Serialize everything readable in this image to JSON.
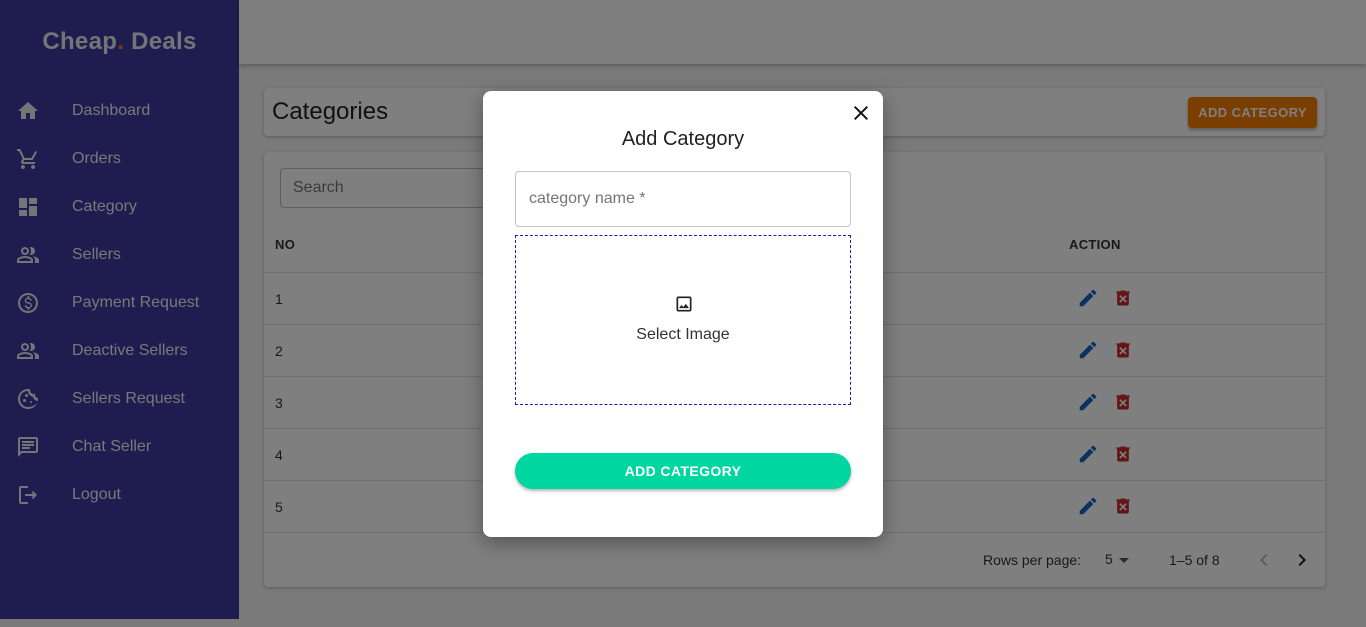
{
  "brand": {
    "name_part1": "Cheap",
    "dot": ".",
    "name_part2": " Deals"
  },
  "sidebar": {
    "items": [
      {
        "label": "Dashboard",
        "icon": "home-icon"
      },
      {
        "label": "Orders",
        "icon": "cart-icon"
      },
      {
        "label": "Category",
        "icon": "dashboard-grid-icon"
      },
      {
        "label": "Sellers",
        "icon": "people-icon"
      },
      {
        "label": "Payment Request",
        "icon": "dollar-circle-icon"
      },
      {
        "label": "Deactive Sellers",
        "icon": "people-icon"
      },
      {
        "label": "Sellers Request",
        "icon": "cookie-icon"
      },
      {
        "label": "Chat Seller",
        "icon": "chat-icon"
      },
      {
        "label": "Logout",
        "icon": "logout-icon"
      }
    ]
  },
  "page": {
    "title": "Categories",
    "add_button": "ADD CATEGORY"
  },
  "table": {
    "search_placeholder": "Search",
    "headers": {
      "no": "NO",
      "action": "ACTION"
    },
    "rows": [
      {
        "no": "1"
      },
      {
        "no": "2"
      },
      {
        "no": "3"
      },
      {
        "no": "4"
      },
      {
        "no": "5"
      }
    ],
    "pagination": {
      "rows_per_page_label": "Rows per page:",
      "rows_per_page": "5",
      "range": "1–5 of 8"
    }
  },
  "modal": {
    "title": "Add Category",
    "name_placeholder": "category name *",
    "select_image_label": "Select Image",
    "submit_label": "ADD CATEGORY"
  },
  "colors": {
    "sidebar": "#3f3a9e",
    "accent_orange": "#f57c00",
    "submit_green": "#00d7a0",
    "edit_blue": "#1565c0",
    "delete_red": "#c62828"
  }
}
